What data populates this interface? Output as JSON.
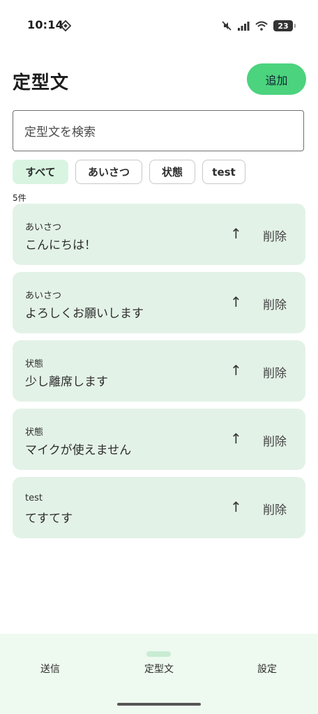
{
  "status_bar": {
    "time": "10:14",
    "battery": "23"
  },
  "header": {
    "title": "定型文",
    "add_label": "追加"
  },
  "search": {
    "placeholder": "定型文を検索"
  },
  "filters": [
    "すべて",
    "あいさつ",
    "状態",
    "test"
  ],
  "count_label": "5件",
  "cards": [
    {
      "category": "あいさつ",
      "text": "こんにちは！",
      "up": "↑",
      "delete": "削除"
    },
    {
      "category": "あいさつ",
      "text": "よろしくお願いします",
      "up": "↑",
      "delete": "削除"
    },
    {
      "category": "状態",
      "text": "少し離席します",
      "up": "↑",
      "delete": "削除"
    },
    {
      "category": "状態",
      "text": "マイクが使えません",
      "up": "↑",
      "delete": "削除"
    },
    {
      "category": "test",
      "text": "てすてす",
      "up": "↑",
      "delete": "削除"
    }
  ],
  "bottom_nav": {
    "send": "送信",
    "templates": "定型文",
    "settings": "設定"
  }
}
